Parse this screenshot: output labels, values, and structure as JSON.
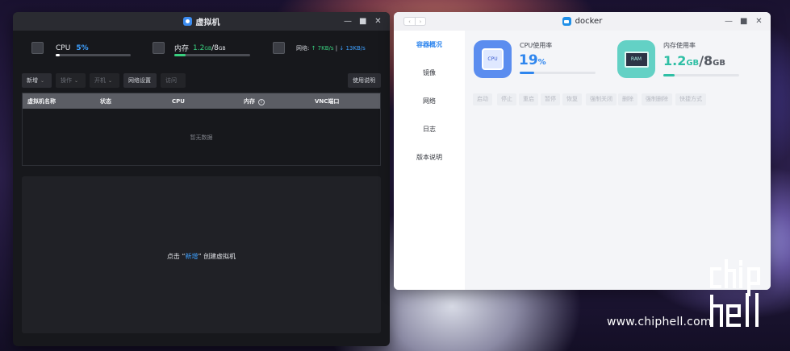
{
  "vm_window": {
    "title": "虚拟机",
    "controls": {
      "min": "—",
      "max": "■",
      "close": "✕"
    },
    "stats": {
      "cpu_label": "CPU",
      "cpu_value": "5%",
      "cpu_progress": 0.05,
      "mem_label": "内存",
      "mem_used": "1.2",
      "mem_used_unit": "GB",
      "mem_sep": "/",
      "mem_total": "8",
      "mem_total_unit": "GB",
      "mem_progress": 0.15,
      "net_label": "网络:",
      "net_up": "↑ 7KB/s",
      "net_sep": " | ",
      "net_down": "↓ 13KB/s"
    },
    "toolbar": {
      "new_label": "新增",
      "ops_label": "操作",
      "power_label": "开机",
      "netcfg_label": "网络设置",
      "visit_label": "访问",
      "help_label": "使用说明"
    },
    "table": {
      "columns": [
        "虚拟机名称",
        "状态",
        "CPU",
        "内存",
        "VNC端口"
      ],
      "info_glyph": "i",
      "empty_text": "暂无数据"
    },
    "create": {
      "prefix": "点击 “",
      "link": "新增",
      "suffix": "” 创建虚拟机"
    },
    "colors": {
      "accent": "#3ea0ff",
      "mem": "#39d07f"
    }
  },
  "docker_window": {
    "title": "docker",
    "nav_back": "‹",
    "nav_fwd": "›",
    "controls": {
      "min": "—",
      "max": "■",
      "close": "✕"
    },
    "sidebar": [
      "容器概况",
      "镜像",
      "网络",
      "日志",
      "版本说明"
    ],
    "active_tab": "容器概况",
    "cpu": {
      "label": "CPU使用率",
      "icon_text": "CPU",
      "value": "19",
      "unit": "%",
      "progress": 0.19
    },
    "mem": {
      "label": "内存使用率",
      "icon_text": "RAM",
      "used": "1.2",
      "used_unit": "GB",
      "sep": "/",
      "total": "8",
      "total_unit": "GB",
      "progress": 0.15
    },
    "actions": [
      "启动",
      "停止",
      "重启",
      "暂停",
      "恢复",
      "强制关闭",
      "删除",
      "强制删除",
      "快捷方式"
    ],
    "colors": {
      "accent": "#2f86ee",
      "cpu_icon_bg": "#5b8def",
      "mem_icon_bg": "#63d1c5",
      "mem_value": "#2fbfa5"
    }
  },
  "watermark": {
    "logo_text": "chip hell",
    "site": "www.chiphell.com"
  }
}
